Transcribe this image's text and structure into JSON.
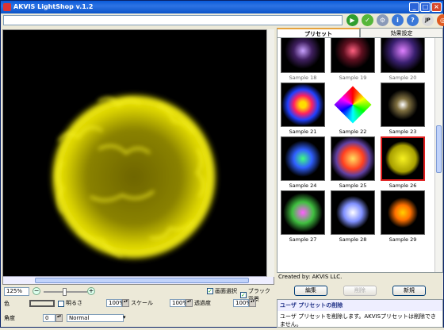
{
  "window": {
    "title": "AKVIS LightShop v.1.2"
  },
  "toolbar": {
    "path_value": "",
    "lang_label": "JP"
  },
  "zoom": {
    "value": "125%",
    "minus": "−",
    "plus": "+"
  },
  "options": {
    "select_area_label": "画面選択",
    "black_bg_label": "ブラック背景"
  },
  "params": {
    "color_label": "色",
    "brightness_label": "明るさ",
    "brightness_value": "100%",
    "scale_label": "スケール",
    "scale_value": "100%",
    "opacity_label": "透過度",
    "opacity_value": "100%",
    "angle_label": "角度",
    "angle_value": "0",
    "blend_value": "Normal"
  },
  "tabs": {
    "presets": "プリセット",
    "effects": "効果設定"
  },
  "presets": [
    {
      "label": "Sample 18"
    },
    {
      "label": "Sample 19"
    },
    {
      "label": "Sample 20"
    },
    {
      "label": "Sample 21"
    },
    {
      "label": "Sample 22"
    },
    {
      "label": "Sample 23"
    },
    {
      "label": "Sample 24"
    },
    {
      "label": "Sample 25"
    },
    {
      "label": "Sample 26"
    },
    {
      "label": "Sample 27"
    },
    {
      "label": "Sample 28"
    },
    {
      "label": "Sample 29"
    }
  ],
  "credit": "Created by: AKVIS LLC.",
  "buttons": {
    "edit": "編集",
    "delete": "削除",
    "new": "新規"
  },
  "info": {
    "heading": "ユーザ プリセットの削除",
    "text": "ユーザ プリセットを削除します。AKVISプリセットは削除できません。"
  },
  "colors": {
    "accent_selected": "#e01d1d",
    "glow": "#e5e000"
  }
}
